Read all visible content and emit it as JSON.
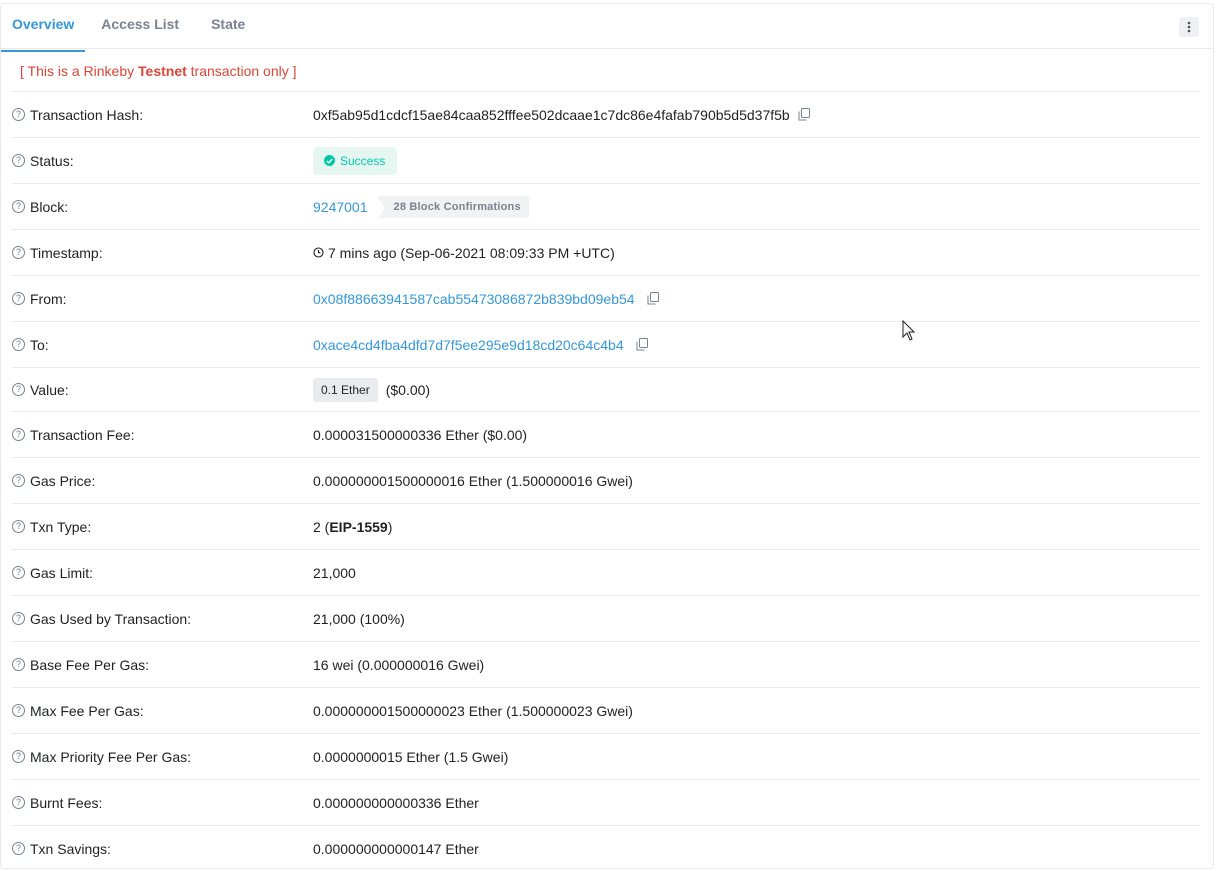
{
  "tabs": [
    {
      "label": "Overview",
      "active": true
    },
    {
      "label": "Access List",
      "active": false
    },
    {
      "label": "State",
      "active": false
    }
  ],
  "notice": {
    "prefix": "[ This is a Rinkeby ",
    "bold": "Testnet",
    "suffix": " transaction only ]"
  },
  "rows": {
    "tx_hash": {
      "label": "Transaction Hash:",
      "value": "0xf5ab95d1cdcf15ae84caa852fffee502dcaae1c7dc86e4fafab790b5d5d37f5b"
    },
    "status": {
      "label": "Status:",
      "value": "Success"
    },
    "block": {
      "label": "Block:",
      "value": "9247001",
      "confirmations": "28 Block Confirmations"
    },
    "timestamp": {
      "label": "Timestamp:",
      "value": "7 mins ago (Sep-06-2021 08:09:33 PM +UTC)"
    },
    "from": {
      "label": "From:",
      "value": "0x08f88663941587cab55473086872b839bd09eb54"
    },
    "to": {
      "label": "To:",
      "value": "0xace4cd4fba4dfd7d7f5ee295e9d18cd20c64c4b4"
    },
    "value": {
      "label": "Value:",
      "amount": "0.1 Ether",
      "usd": "($0.00)"
    },
    "tx_fee": {
      "label": "Transaction Fee:",
      "value": "0.000031500000336 Ether ($0.00)"
    },
    "gas_price": {
      "label": "Gas Price:",
      "value": "0.000000001500000016 Ether (1.500000016 Gwei)"
    },
    "txn_type": {
      "label": "Txn Type:",
      "prefix": "2 (",
      "bold": "EIP-1559",
      "suffix": ")"
    },
    "gas_limit": {
      "label": "Gas Limit:",
      "value": "21,000"
    },
    "gas_used": {
      "label": "Gas Used by Transaction:",
      "value": "21,000 (100%)"
    },
    "base_fee": {
      "label": "Base Fee Per Gas:",
      "value": "16 wei (0.000000016 Gwei)"
    },
    "max_fee": {
      "label": "Max Fee Per Gas:",
      "value": "0.000000001500000023 Ether (1.500000023 Gwei)"
    },
    "max_priority": {
      "label": "Max Priority Fee Per Gas:",
      "value": "0.0000000015 Ether (1.5 Gwei)"
    },
    "burnt_fees": {
      "label": "Burnt Fees:",
      "value": "0.000000000000336 Ether"
    },
    "txn_savings": {
      "label": "Txn Savings:",
      "value": "0.000000000000147 Ether"
    }
  },
  "colors": {
    "accent": "#3498db",
    "success": "#00c9a7",
    "danger": "#de4437",
    "muted": "#77838f"
  },
  "icons": {
    "help": "question-circle-icon",
    "copy": "copy-icon",
    "clock": "clock-icon",
    "check": "check-circle-icon",
    "more": "more-vertical-icon",
    "cursor": "mouse-cursor-icon"
  }
}
